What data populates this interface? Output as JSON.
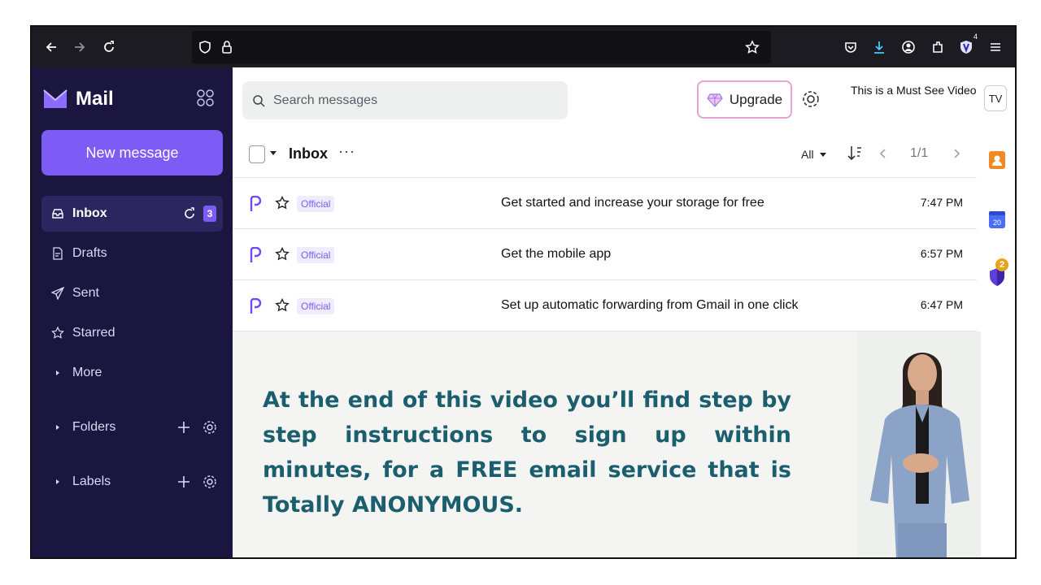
{
  "browser": {
    "icons": [
      "back-arrow-icon",
      "forward-arrow-icon",
      "reload-icon",
      "shield-icon",
      "lock-icon",
      "bookmark-star-icon",
      "pocket-icon",
      "download-icon",
      "account-icon",
      "extensions-icon",
      "vpn-extension-icon",
      "menu-icon"
    ],
    "extension_badge": "4"
  },
  "sidebar": {
    "logo_text": "Mail",
    "new_message_label": "New message",
    "items": [
      {
        "label": "Inbox",
        "badge": "3"
      },
      {
        "label": "Drafts"
      },
      {
        "label": "Sent"
      },
      {
        "label": "Starred"
      },
      {
        "label": "More"
      }
    ],
    "folders_label": "Folders",
    "labels_label": "Labels"
  },
  "header": {
    "search_placeholder": "Search messages",
    "upgrade_label": "Upgrade",
    "user_name": "This is a Must See Video",
    "avatar_initials": "TV"
  },
  "inbox": {
    "title": "Inbox",
    "more_dots": "···",
    "filter_label": "All",
    "pagination": "1/1",
    "messages": [
      {
        "tag": "Official",
        "subject": "Get started and increase your storage for free",
        "time": "7:47 PM"
      },
      {
        "tag": "Official",
        "subject": "Get the mobile app",
        "time": "6:57 PM"
      },
      {
        "tag": "Official",
        "subject": "Set up automatic forwarding from Gmail in one click",
        "time": "6:47 PM"
      }
    ]
  },
  "promo": {
    "text": "At the end of this video you’ll find step by step instructions to sign up within minutes, for a FREE email service  that is Totally ANONYMOUS."
  },
  "rail": {
    "calendar_day": "20",
    "vpn_badge": "2"
  },
  "colors": {
    "sidebar_bg": "#1b1640",
    "accent": "#7c5cf5",
    "browser_bar": "#1c1b22",
    "promo_text": "#1b5f6e"
  }
}
